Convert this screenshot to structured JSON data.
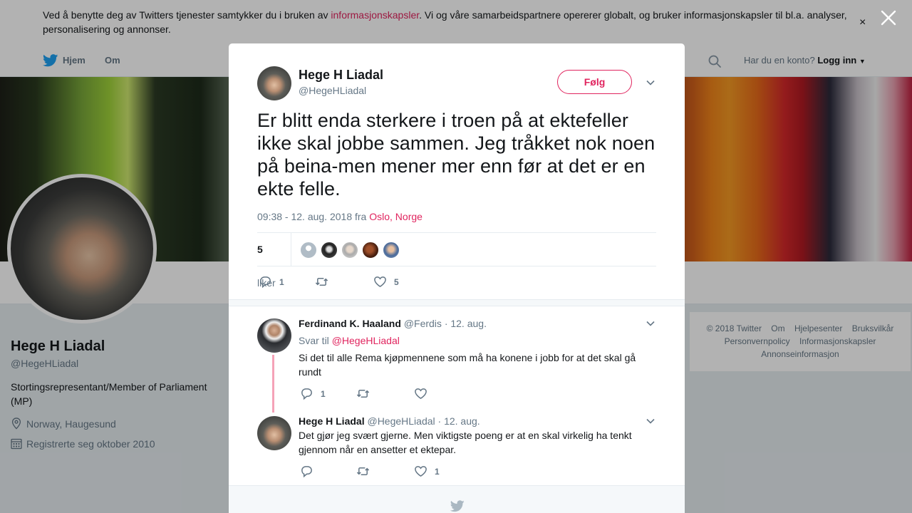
{
  "cookie_bar": {
    "text_before": "Ved å benytte deg av Twitters tjenester samtykker du i bruken av ",
    "link": "informasjonskapsler",
    "text_after": ". Vi og våre samarbeidspartnere opererer globalt, og bruker informasjonskapsler til bl.a. analyser, personalisering og annonser.",
    "close_symbol": "×"
  },
  "nav": {
    "home_label": "Hjem",
    "about_label": "Om",
    "account_prompt": "Har du en konto?",
    "login_label": "Logg inn"
  },
  "profile": {
    "name": "Hege H Liadal",
    "handle": "@HegeHLiadal",
    "bio": "Stortingsrepresentant/Member of Parliament (MP)",
    "location": "Norway, Haugesund",
    "joined": "Registrerte seg oktober 2010"
  },
  "footer": {
    "copyright": "© 2018 Twitter",
    "links": [
      "Om",
      "Hjelpesenter",
      "Bruksvilkår",
      "Personvernpolicy",
      "Informasjonskapsler",
      "Annonseinformasjon"
    ]
  },
  "tweet": {
    "author_name": "Hege H Liadal",
    "author_handle": "@HegeHLiadal",
    "follow_label": "Følg",
    "text": "Er blitt enda sterkere i troen på at ektefeller ikke skal jobbe sammen. Jeg tråkket nok noen på beina-men mener mer enn før at det er en ekte felle.",
    "timestamp": "09:38 - 12. aug. 2018 fra ",
    "location": "Oslo, Norge",
    "likes_count": "5",
    "likes_label": "liker",
    "reply_count": "1",
    "retweet_count": "",
    "like_count": "5"
  },
  "replies": [
    {
      "name": "Ferdinand K. Haaland",
      "handle": "@Ferdis",
      "date": "· 12. aug.",
      "reply_to_label": "Svar til",
      "reply_to_handle": "@HegeHLiadal",
      "text": "Si det til alle Rema kjøpmennene som må ha konene i jobb for at det skal gå rundt",
      "reply_count": "1",
      "retweet_count": "",
      "like_count": ""
    },
    {
      "name": "Hege H Liadal",
      "handle": "@HegeHLiadal",
      "date": "· 12. aug.",
      "text": "Det gjør jeg svært gjerne. Men viktigste poeng er at en skal virkelig ha tenkt gjennom når en ansetter et ektepar.",
      "reply_count": "",
      "retweet_count": "",
      "like_count": "1"
    }
  ],
  "colors": {
    "accent": "#e0245e",
    "twitter_blue": "#1da1f2",
    "muted": "#657786"
  }
}
